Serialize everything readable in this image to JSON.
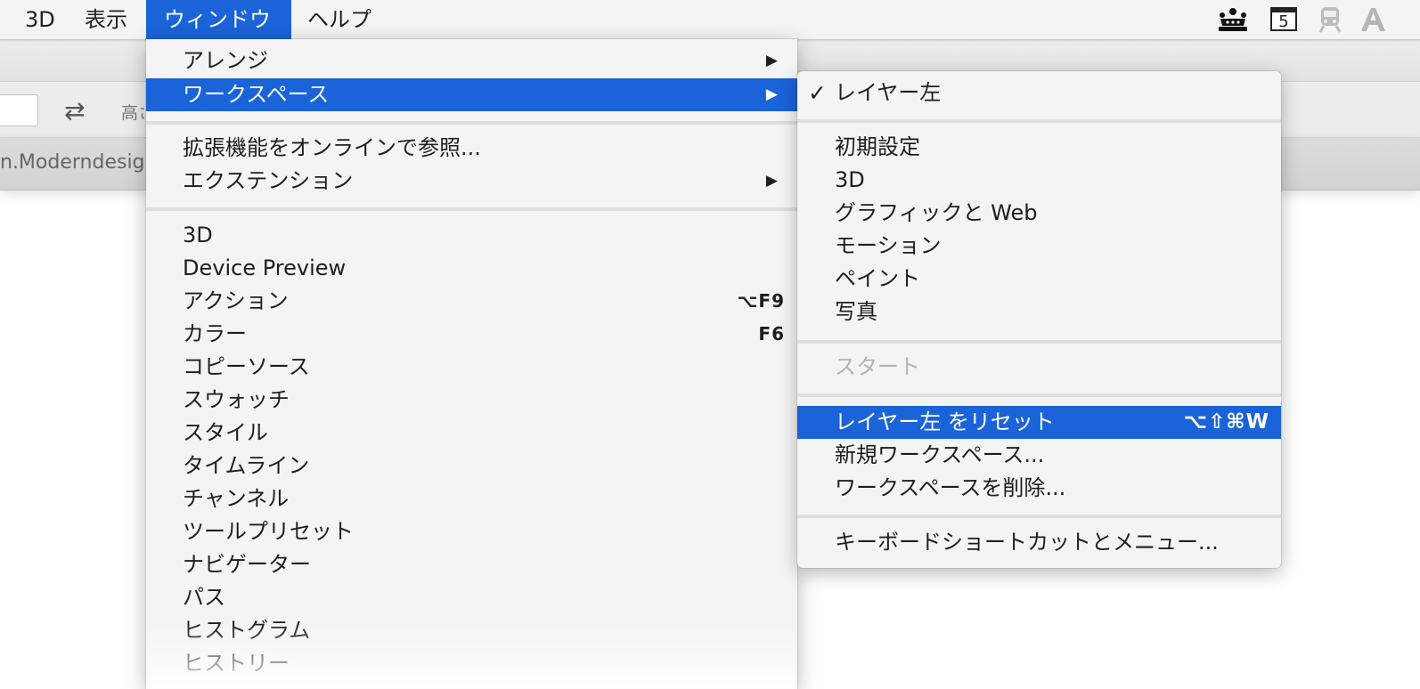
{
  "menubar": {
    "items": [
      "3D",
      "表示",
      "ウィンドウ",
      "ヘルプ"
    ],
    "active_index": 2,
    "status_icons": [
      "crown-icon",
      "calendar-icon",
      "train-icon",
      "font-a-icon"
    ],
    "calendar_day": "5"
  },
  "app": {
    "options_label": "高さ",
    "tab_title": "n.Moderndesig"
  },
  "main_menu": {
    "items": [
      {
        "label": "アレンジ",
        "submenu": true
      },
      {
        "label": "ワークスペース",
        "submenu": true,
        "highlighted": true
      },
      {
        "label": "拡張機能をオンラインで参照..."
      },
      {
        "label": "エクステンション",
        "submenu": true
      },
      {
        "label": "3D"
      },
      {
        "label": "Device Preview"
      },
      {
        "label": "アクション",
        "shortcut": "⌥F9"
      },
      {
        "label": "カラー",
        "shortcut": "F6"
      },
      {
        "label": "コピーソース"
      },
      {
        "label": "スウォッチ"
      },
      {
        "label": "スタイル"
      },
      {
        "label": "タイムライン"
      },
      {
        "label": "チャンネル"
      },
      {
        "label": "ツールプリセット"
      },
      {
        "label": "ナビゲーター"
      },
      {
        "label": "パス"
      },
      {
        "label": "ヒストグラム"
      },
      {
        "label": "ヒストリー"
      }
    ],
    "arrow_glyph": "▶"
  },
  "workspace_submenu": {
    "checkmark": "✓",
    "items": [
      {
        "label": "レイヤー左",
        "checked": true
      },
      {
        "label": "初期設定"
      },
      {
        "label": "3D"
      },
      {
        "label": "グラフィックと Web"
      },
      {
        "label": "モーション"
      },
      {
        "label": "ペイント"
      },
      {
        "label": "写真"
      },
      {
        "label": "スタート",
        "disabled": true
      },
      {
        "label": "レイヤー左 をリセット",
        "shortcut": "⌥⇧⌘W",
        "highlighted": true
      },
      {
        "label": "新規ワークスペース..."
      },
      {
        "label": "ワークスペースを削除..."
      },
      {
        "label": "キーボードショートカットとメニュー..."
      }
    ]
  },
  "colors": {
    "highlight": "#1a63d8",
    "menu_bg": "#f4f4f4",
    "disabled_text": "#b2b2b2"
  }
}
